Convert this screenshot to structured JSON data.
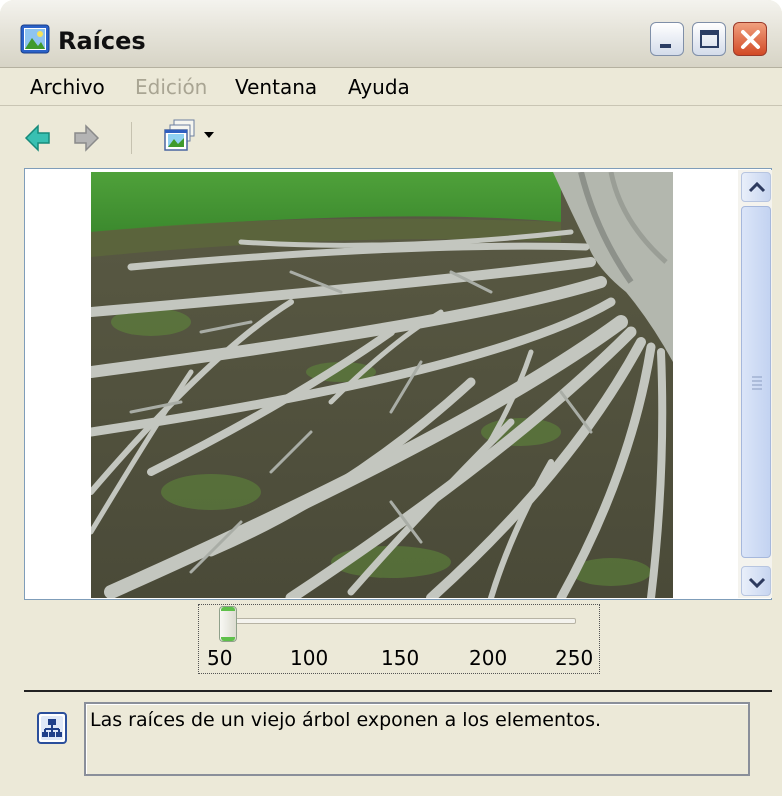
{
  "window": {
    "title": "Raíces",
    "icon": "picture-icon"
  },
  "menu": {
    "items": [
      {
        "label": "Archivo",
        "enabled": true
      },
      {
        "label": "Edición",
        "enabled": false
      },
      {
        "label": "Ventana",
        "enabled": true
      },
      {
        "label": "Ayuda",
        "enabled": true
      }
    ]
  },
  "toolbar": {
    "back_icon": "back-arrow-icon",
    "forward_icon": "forward-arrow-icon",
    "views_icon": "views-menu-icon"
  },
  "slider": {
    "value": 50,
    "ticks": [
      "50",
      "100",
      "150",
      "200",
      "250"
    ]
  },
  "description": {
    "text": "Las raíces de un viejo árbol exponen a los elementos."
  },
  "colors": {
    "window_bg": "#ece9d8",
    "close_button": "#d24a26",
    "slider_accent": "#5ec04a",
    "viewer_border": "#7f9db9"
  }
}
